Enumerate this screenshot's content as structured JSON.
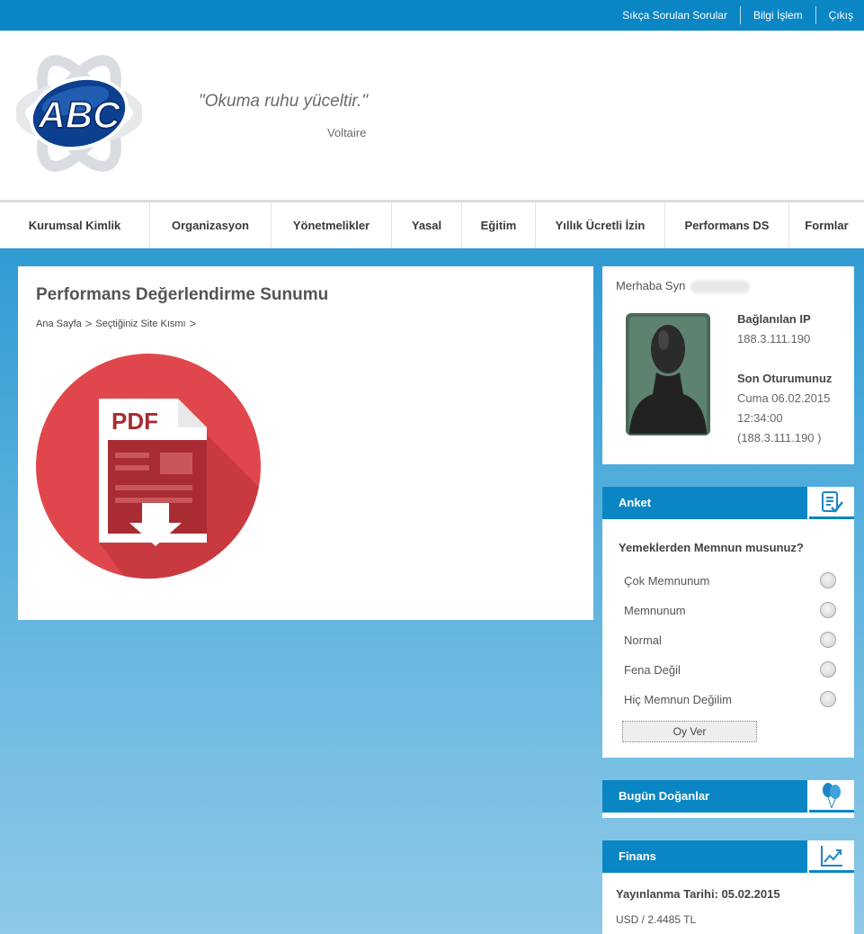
{
  "topbar": {
    "links": [
      "Sıkça Sorulan Sorular",
      "Bilgi İşlem",
      "Çıkış"
    ]
  },
  "header": {
    "logo_text": "ABC",
    "quote": "\"Okuma ruhu yüceltir.\"",
    "author": "Voltaire"
  },
  "nav": {
    "items": [
      "Kurumsal Kimlik",
      "Organizasyon",
      "Yönetmelikler",
      "Yasal",
      "Eğitim",
      "Yıllık Ücretli İzin",
      "Performans DS",
      "Formlar"
    ]
  },
  "main": {
    "title": "Performans Değerlendirme Sunumu",
    "breadcrumb": [
      "Ana Sayfa",
      "Seçtiğiniz Site Kısmı"
    ],
    "pdf_label": "PDF"
  },
  "user": {
    "greeting": "Merhaba Syn",
    "ip_label": "Bağlanılan IP",
    "ip_value": "188.3.111.190",
    "session_label": "Son Oturumunuz",
    "session_date": "Cuma 06.02.2015",
    "session_time": "12:34:00",
    "session_ip": "(188.3.111.190 )"
  },
  "poll": {
    "title": "Anket",
    "icon": "survey-check-icon",
    "question": "Yemeklerden Memnun musunuz?",
    "options": [
      "Çok Memnunum",
      "Memnunum",
      "Normal",
      "Fena Değil",
      "Hiç Memnun Değilim"
    ],
    "button": "Oy Ver"
  },
  "birthdays": {
    "title": "Bugün Doğanlar",
    "icon": "balloons-icon"
  },
  "finance": {
    "title": "Finans",
    "icon": "chart-up-icon",
    "date_line": "Yayınlanma Tarihi: 05.02.2015",
    "rate_line": "USD / 2.4485 TL"
  },
  "colors": {
    "brand_blue": "#0a86c4",
    "pdf_red": "#e0474c",
    "pdf_dark": "#a82c32"
  }
}
